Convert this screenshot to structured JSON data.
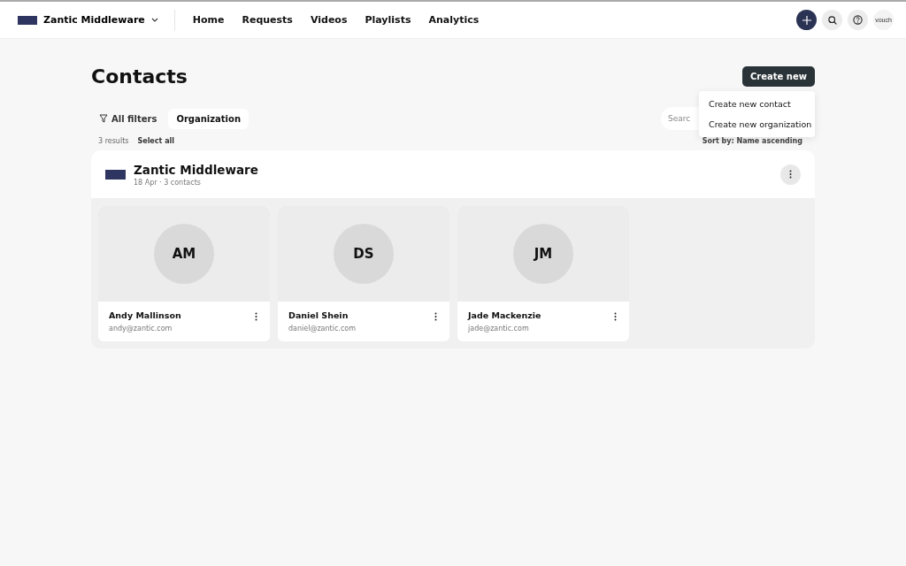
{
  "nav": {
    "workspace": "Zantic Middleware",
    "links": [
      "Home",
      "Requests",
      "Videos",
      "Playlists",
      "Analytics"
    ],
    "account": "vouch"
  },
  "page": {
    "title": "Contacts",
    "create_button": "Create new",
    "create_menu": [
      "Create new contact",
      "Create new organization"
    ],
    "filters": [
      {
        "label": "All filters",
        "selected": false
      },
      {
        "label": "Organization",
        "selected": true
      }
    ],
    "search": {
      "placeholder": "Searc"
    },
    "results": "3 results",
    "select_all": "Select all",
    "sort": "Sort by: Name ascending"
  },
  "organization": {
    "name": "Zantic Middleware",
    "meta": "18 Apr · 3 contacts",
    "contacts": [
      {
        "initials": "AM",
        "name": "Andy Mallinson",
        "email": "andy@zantic.com"
      },
      {
        "initials": "DS",
        "name": "Daniel Shein",
        "email": "daniel@zantic.com"
      },
      {
        "initials": "JM",
        "name": "Jade Mackenzie",
        "email": "jade@zantic.com"
      }
    ]
  }
}
